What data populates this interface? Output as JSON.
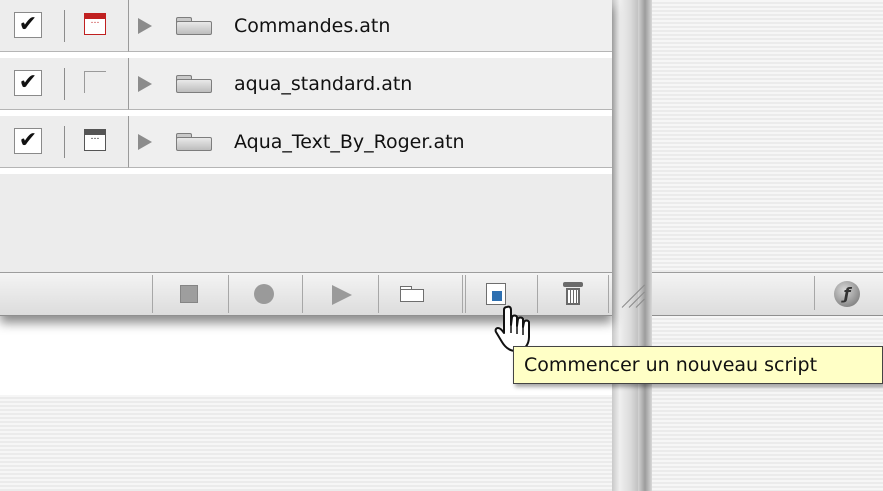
{
  "action_sets": [
    {
      "name": "Commandes.atn",
      "checked": true,
      "dialog_icon": "dialog-red-icon"
    },
    {
      "name": "aqua_standard.atn",
      "checked": true,
      "dialog_icon": "none"
    },
    {
      "name": "Aqua_Text_By_Roger.atn",
      "checked": true,
      "dialog_icon": "dialog-icon"
    }
  ],
  "checkmark": "✔",
  "dialog_glyph": "…",
  "script_glyph": "ƒ",
  "tooltip": "Commencer un nouveau script",
  "icons": {
    "stop": "stop-icon",
    "record": "record-icon",
    "play": "play-icon",
    "new_set": "folder-icon",
    "new_action": "new-script-icon",
    "delete": "trash-icon",
    "resize": "resize-grip-icon",
    "script": "script-icon",
    "cursor": "hand-pointer-icon"
  },
  "colors": {
    "tooltip_bg": "#ffffc6",
    "dialog_red": "#c02020",
    "new_script_blue": "#2d6fb0"
  }
}
